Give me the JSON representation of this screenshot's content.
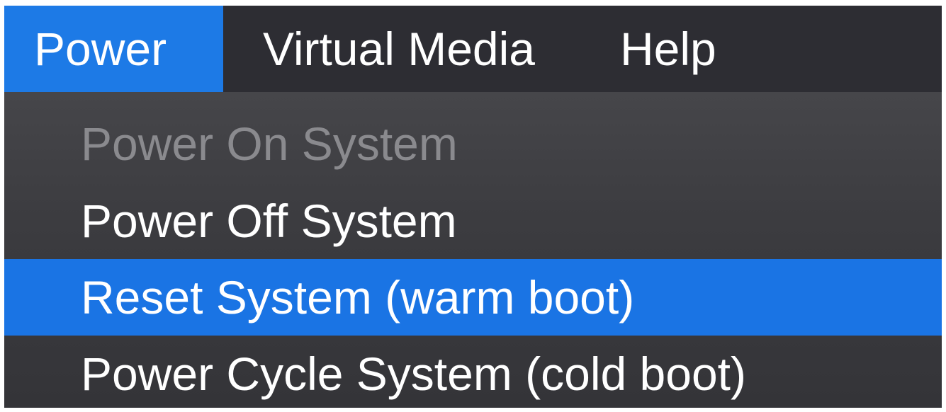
{
  "menubar": {
    "items": [
      {
        "label": "Power",
        "active": true
      },
      {
        "label": "Virtual Media",
        "active": false
      },
      {
        "label": "Help",
        "active": false
      }
    ]
  },
  "dropdown": {
    "items": [
      {
        "label": "Power On System",
        "state": "disabled"
      },
      {
        "label": "Power Off System",
        "state": "enabled"
      },
      {
        "label": "Reset System (warm boot)",
        "state": "highlighted"
      },
      {
        "label": "Power Cycle System (cold boot)",
        "state": "enabled"
      }
    ]
  },
  "colors": {
    "menubar_bg": "#2d2d33",
    "accent": "#1d7ae6",
    "dropdown_bg": "#3c3c40",
    "disabled_text": "#8a8a8e",
    "text": "#ffffff"
  }
}
